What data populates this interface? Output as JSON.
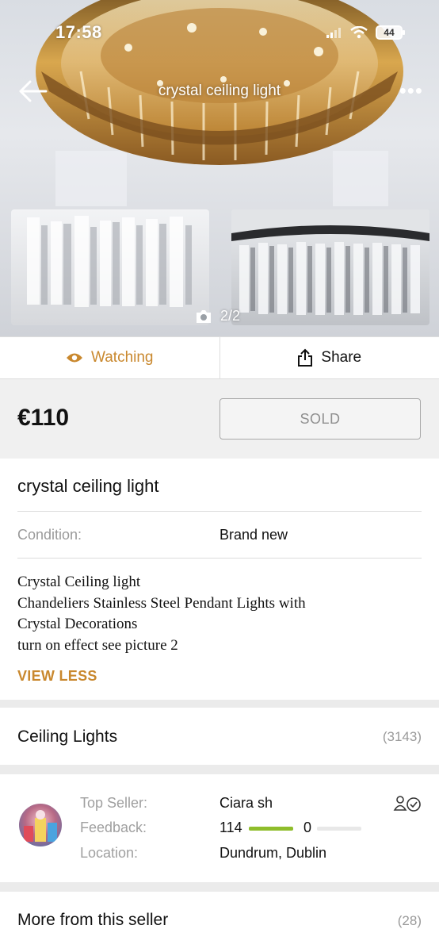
{
  "status_bar": {
    "time": "17:58",
    "battery": "44"
  },
  "nav": {
    "title": "crystal ceiling light"
  },
  "gallery": {
    "photo_counter": "2/2"
  },
  "actions": {
    "watch_label": "Watching",
    "share_label": "Share"
  },
  "listing": {
    "price": "€110",
    "status_button": "SOLD",
    "title": "crystal ceiling light",
    "condition_label": "Condition:",
    "condition_value": "Brand new",
    "description_lines": [
      "Crystal Ceiling light",
      "Chandeliers Stainless Steel Pendant Lights with",
      "Crystal Decorations",
      "turn on effect see picture 2"
    ],
    "view_less": "VIEW LESS"
  },
  "category": {
    "name": "Ceiling Lights",
    "count": "(3143)"
  },
  "seller": {
    "top_seller_label": "Top Seller:",
    "name": "Ciara sh",
    "feedback_label": "Feedback:",
    "feedback_positive": "114",
    "feedback_negative": "0",
    "location_label": "Location:",
    "location": "Dundrum, Dublin"
  },
  "more_from_seller": {
    "label": "More from this seller",
    "count": "(28)"
  },
  "colors": {
    "accent": "#c9882e",
    "feedback_green": "#8fbd2b"
  }
}
